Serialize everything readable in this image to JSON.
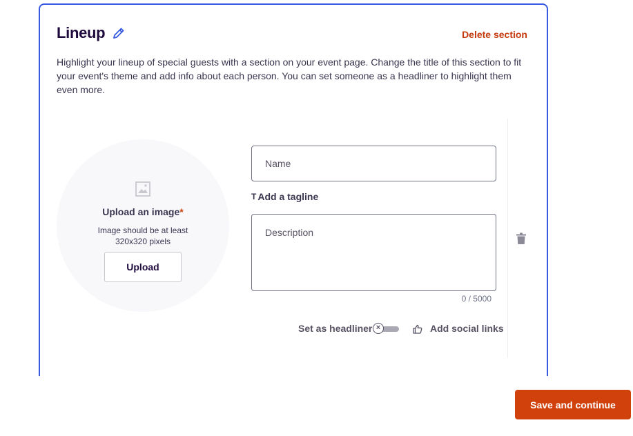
{
  "section": {
    "title": "Lineup",
    "delete_label": "Delete section",
    "description": "Highlight your lineup of special guests with a section on your event page. Change the title of this section to fit your event's theme and add info about each person. You can set someone as a headliner to highlight them even more."
  },
  "upload": {
    "title": "Upload an image",
    "required_mark": "*",
    "hint": "Image should be at least 320x320 pixels",
    "button_label": "Upload"
  },
  "form": {
    "name_placeholder": "Name",
    "tagline_icon": "T",
    "tagline_label": "Add a tagline",
    "description_placeholder": "Description",
    "char_count": "0 / 5000",
    "headliner_label": "Set as headliner",
    "headliner_enabled": false,
    "social_label": "Add social links"
  },
  "footer": {
    "save_label": "Save and continue"
  },
  "colors": {
    "accent_blue": "#3659e3",
    "brand_orange": "#d1410c",
    "text_dark": "#1e0a3c"
  }
}
